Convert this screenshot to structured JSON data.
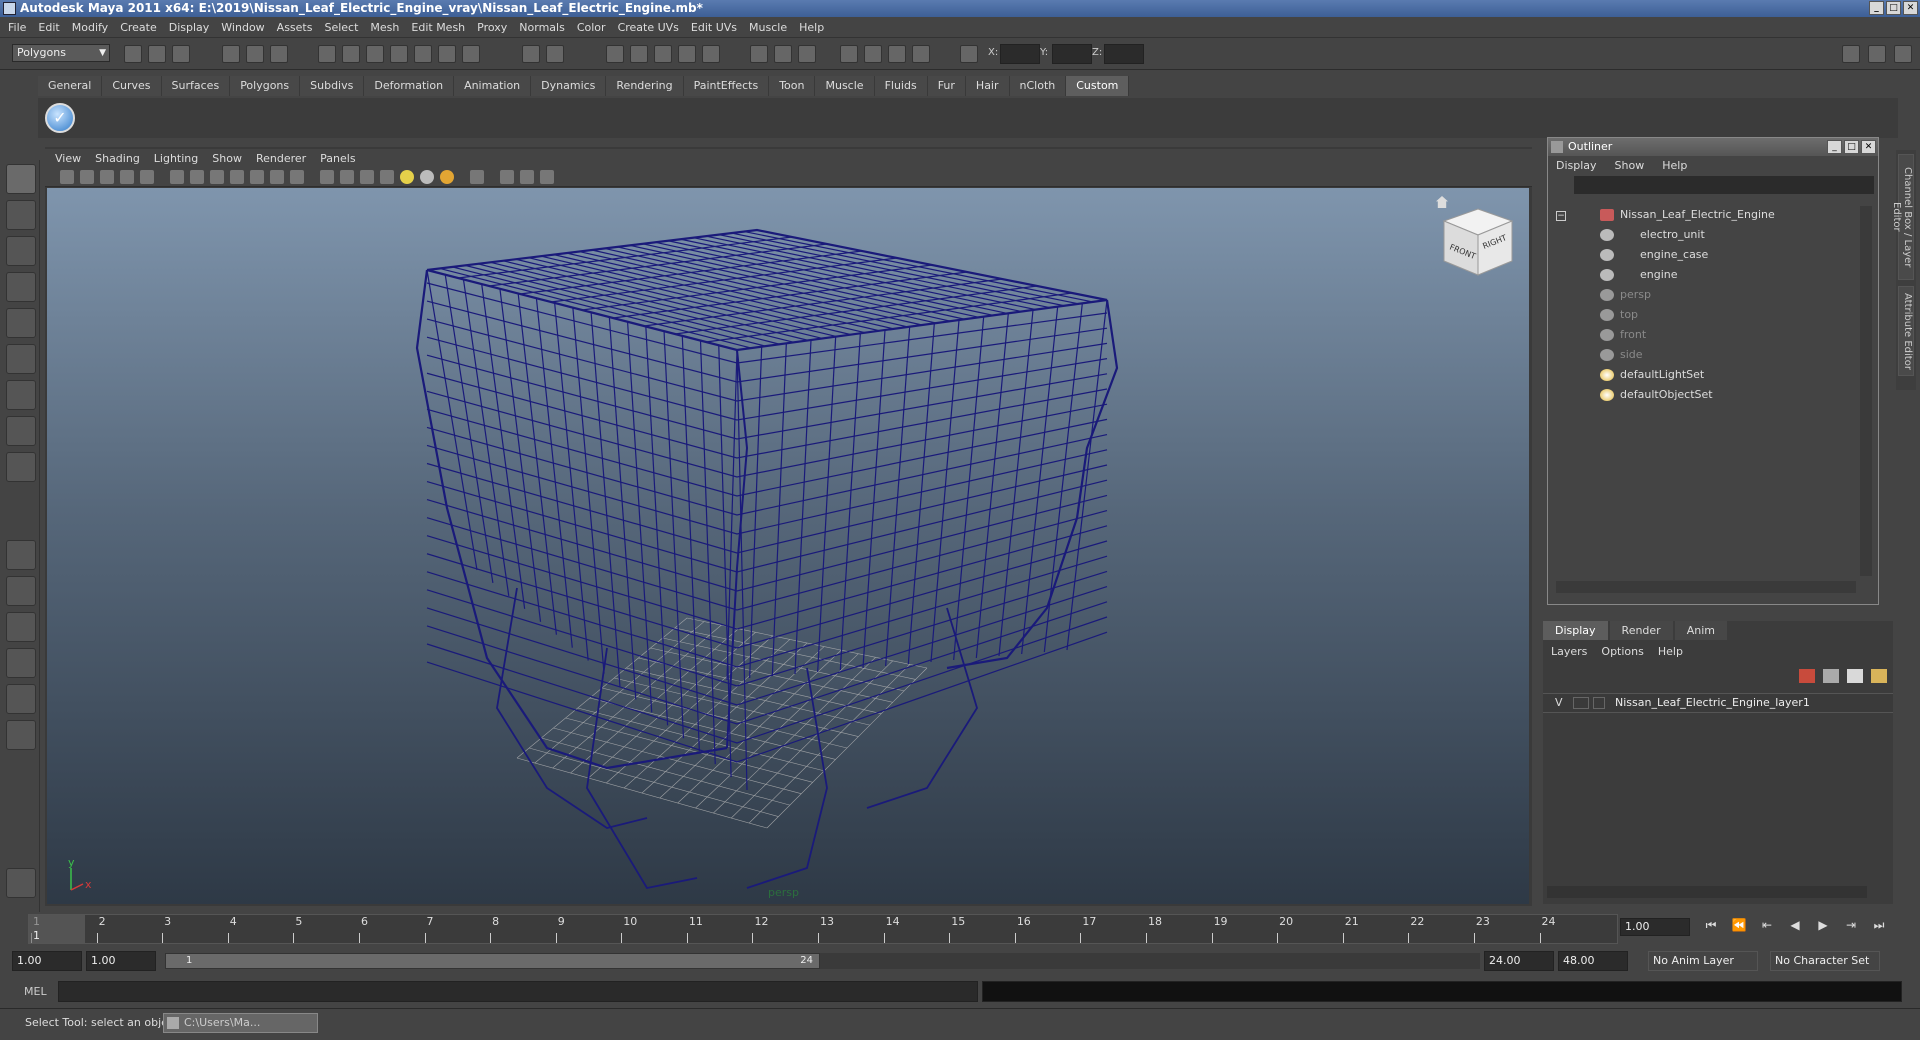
{
  "window": {
    "title": "Autodesk Maya 2011 x64: E:\\2019\\Nissan_Leaf_Electric_Engine_vray\\Nissan_Leaf_Electric_Engine.mb*"
  },
  "menubar": {
    "items": [
      "File",
      "Edit",
      "Modify",
      "Create",
      "Display",
      "Window",
      "Assets",
      "Select",
      "Mesh",
      "Edit Mesh",
      "Proxy",
      "Normals",
      "Color",
      "Create UVs",
      "Edit UVs",
      "Muscle",
      "Help"
    ]
  },
  "statusline": {
    "mode": "Polygons",
    "x_label": "X:",
    "y_label": "Y:",
    "z_label": "Z:"
  },
  "shelf": {
    "tabs": [
      "General",
      "Curves",
      "Surfaces",
      "Polygons",
      "Subdivs",
      "Deformation",
      "Animation",
      "Dynamics",
      "Rendering",
      "PaintEffects",
      "Toon",
      "Muscle",
      "Fluids",
      "Fur",
      "Hair",
      "nCloth",
      "Custom"
    ],
    "active_tab": "Custom"
  },
  "viewport": {
    "menu": [
      "View",
      "Shading",
      "Lighting",
      "Show",
      "Renderer",
      "Panels"
    ],
    "camera_label": "persp",
    "viewcube_front": "FRONT",
    "viewcube_right": "RIGHT",
    "axis_x": "x",
    "axis_y": "y",
    "wire_color": "#1a1a7a",
    "grid_color": "#b8b8b8"
  },
  "outliner": {
    "title": "Outliner",
    "menu": [
      "Display",
      "Show",
      "Help"
    ],
    "items": [
      {
        "label": "Nissan_Leaf_Electric_Engine",
        "level": 0,
        "dim": false
      },
      {
        "label": "electro_unit",
        "level": 1,
        "dim": false
      },
      {
        "label": "engine_case",
        "level": 1,
        "dim": false
      },
      {
        "label": "engine",
        "level": 1,
        "dim": false
      },
      {
        "label": "persp",
        "level": 0,
        "dim": true
      },
      {
        "label": "top",
        "level": 0,
        "dim": true
      },
      {
        "label": "front",
        "level": 0,
        "dim": true
      },
      {
        "label": "side",
        "level": 0,
        "dim": true
      },
      {
        "label": "defaultLightSet",
        "level": 0,
        "dim": false
      },
      {
        "label": "defaultObjectSet",
        "level": 0,
        "dim": false
      }
    ]
  },
  "side_tabs": [
    "Channel Box / Layer Editor",
    "Attribute Editor"
  ],
  "layers": {
    "tabs": [
      "Display",
      "Render",
      "Anim"
    ],
    "active_tab": "Display",
    "menu": [
      "Layers",
      "Options",
      "Help"
    ],
    "rows": [
      {
        "visible": "V",
        "name": "Nissan_Leaf_Electric_Engine_layer1"
      }
    ]
  },
  "timeline": {
    "ticks": [
      "1",
      "2",
      "3",
      "4",
      "5",
      "6",
      "7",
      "8",
      "9",
      "10",
      "11",
      "12",
      "13",
      "14",
      "15",
      "16",
      "17",
      "18",
      "19",
      "20",
      "21",
      "22",
      "23",
      "24"
    ],
    "current_marker": "1",
    "current_frame": "1.00",
    "playback": [
      "⏮",
      "⏪",
      "⇤",
      "◀",
      "▶",
      "⇥",
      "⏭"
    ]
  },
  "range": {
    "start_time": "1.00",
    "playback_start": "1.00",
    "slider_start": "1",
    "slider_end": "24",
    "playback_end": "24.00",
    "end_time": "48.00",
    "anim_layer": "No Anim Layer",
    "character_set": "No Character Set"
  },
  "command": {
    "mel_label": "MEL"
  },
  "help": {
    "text": "Select Tool: select an object",
    "task": "C:\\Users\\Ma..."
  }
}
